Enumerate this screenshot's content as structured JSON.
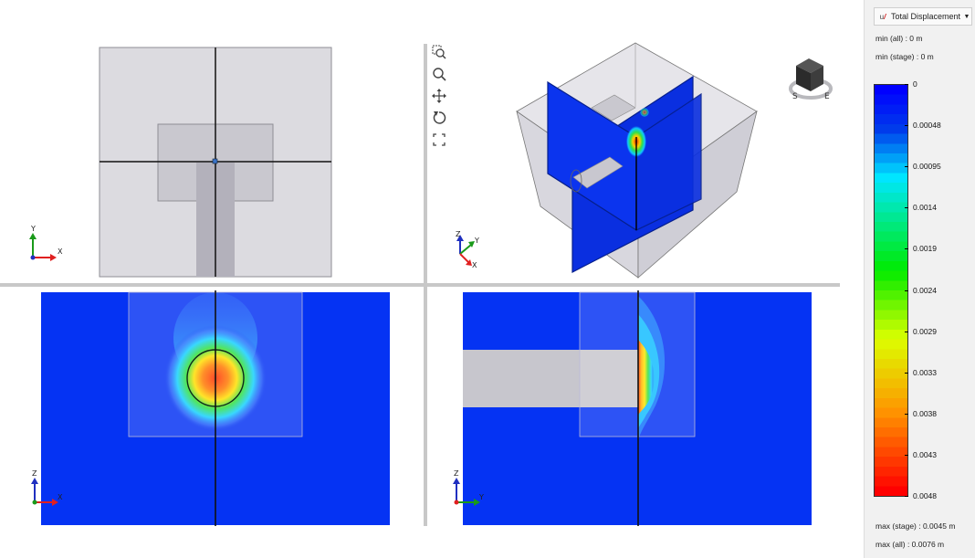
{
  "legend": {
    "title": "Total Displacement",
    "min_all": "min (all) :    0 m",
    "min_stage": "min (stage) : 0 m",
    "max_stage": "max (stage) : 0.0045 m",
    "max_all": "max (all) :    0.0076 m",
    "ticks": [
      "0",
      "0.00048",
      "0.00095",
      "0.0014",
      "0.0019",
      "0.0024",
      "0.0029",
      "0.0033",
      "0.0038",
      "0.0043",
      "0.0048"
    ],
    "colors": {
      "min": "#0000ff",
      "mid": "#00ff00",
      "max": "#ff0000"
    }
  },
  "toolbar": {
    "tools": [
      "zoom-window-icon",
      "zoom-icon",
      "pan-icon",
      "rotate-icon",
      "fit-view-icon"
    ]
  },
  "viewports": {
    "top_view": {
      "axes": [
        "Y",
        "X"
      ]
    },
    "perspective_view": {
      "axes": [
        "Z",
        "Y",
        "X"
      ]
    },
    "front_view": {
      "axes": [
        "Z",
        "X"
      ]
    },
    "side_view": {
      "axes": [
        "Z",
        "Y"
      ]
    }
  },
  "view_cube": {
    "compass": [
      "S",
      "E"
    ]
  }
}
